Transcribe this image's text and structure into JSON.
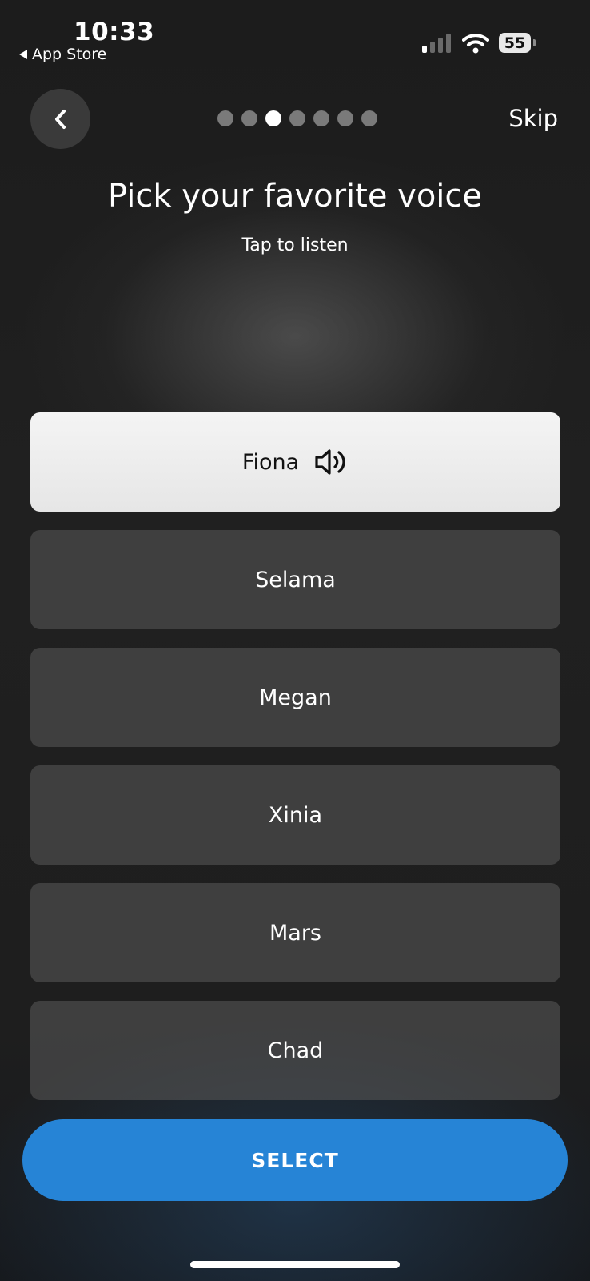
{
  "status_bar": {
    "time": "10:33",
    "back_app": "App Store",
    "battery": "55"
  },
  "header": {
    "progress_total": 7,
    "progress_current": 3,
    "skip_label": "Skip"
  },
  "title": "Pick your favorite voice",
  "subtitle": "Tap to listen",
  "voices": [
    {
      "name": "Fiona",
      "selected": true
    },
    {
      "name": "Selama",
      "selected": false
    },
    {
      "name": "Megan",
      "selected": false
    },
    {
      "name": "Xinia",
      "selected": false
    },
    {
      "name": "Mars",
      "selected": false
    },
    {
      "name": "Chad",
      "selected": false
    }
  ],
  "select_label": "SELECT",
  "colors": {
    "accent": "#2684d6",
    "background": "#1d1d1d",
    "selected_card": "#eeeeee",
    "card": "#555555"
  }
}
